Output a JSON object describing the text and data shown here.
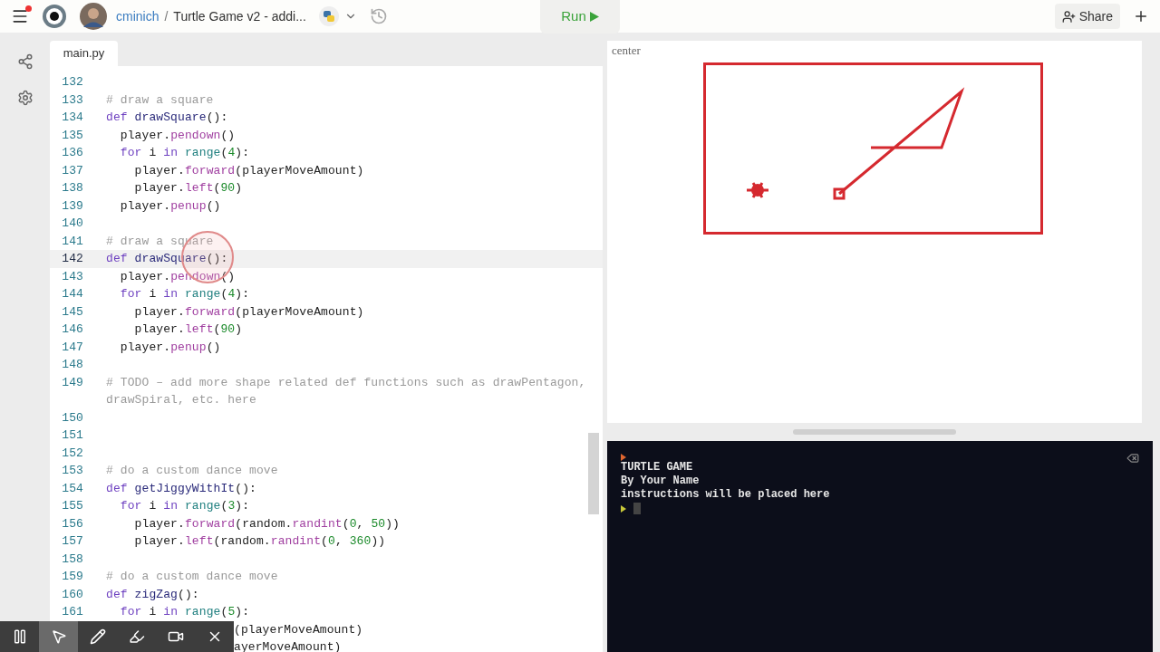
{
  "header": {
    "menu_badge": true,
    "user": "cminich",
    "separator": "/",
    "project": "Turtle Game v2 - addi...",
    "run_label": "Run",
    "share_label": "Share"
  },
  "editor": {
    "tab": "main.py",
    "lines": [
      {
        "number": "132",
        "active": false
      },
      {
        "number": "133",
        "active": false,
        "tokens": [
          {
            "kind": "comment",
            "text": "# draw a square"
          }
        ]
      },
      {
        "number": "134",
        "active": false,
        "tokens": [
          {
            "kind": "kw",
            "text": "def "
          },
          {
            "kind": "defname",
            "text": "drawSquare"
          },
          {
            "kind": "plain",
            "text": "():"
          }
        ]
      },
      {
        "number": "135",
        "active": false,
        "tokens": [
          {
            "kind": "plain",
            "text": "  player."
          },
          {
            "kind": "method",
            "text": "pendown"
          },
          {
            "kind": "plain",
            "text": "()"
          }
        ]
      },
      {
        "number": "136",
        "active": false,
        "tokens": [
          {
            "kind": "kw",
            "text": "  for"
          },
          {
            "kind": "plain",
            "text": " i "
          },
          {
            "kind": "kw",
            "text": "in "
          },
          {
            "kind": "builtin",
            "text": "range"
          },
          {
            "kind": "plain",
            "text": "("
          },
          {
            "kind": "num",
            "text": "4"
          },
          {
            "kind": "plain",
            "text": "):"
          }
        ]
      },
      {
        "number": "137",
        "active": false,
        "tokens": [
          {
            "kind": "plain",
            "text": "    player."
          },
          {
            "kind": "method",
            "text": "forward"
          },
          {
            "kind": "plain",
            "text": "(playerMoveAmount)"
          }
        ]
      },
      {
        "number": "138",
        "active": false,
        "tokens": [
          {
            "kind": "plain",
            "text": "    player."
          },
          {
            "kind": "method",
            "text": "left"
          },
          {
            "kind": "plain",
            "text": "("
          },
          {
            "kind": "num",
            "text": "90"
          },
          {
            "kind": "plain",
            "text": ")"
          }
        ]
      },
      {
        "number": "139",
        "active": false,
        "tokens": [
          {
            "kind": "plain",
            "text": "  player."
          },
          {
            "kind": "method",
            "text": "penup"
          },
          {
            "kind": "plain",
            "text": "()"
          }
        ]
      },
      {
        "number": "140",
        "active": false
      },
      {
        "number": "141",
        "active": false,
        "tokens": [
          {
            "kind": "comment",
            "text": "# draw a square"
          }
        ]
      },
      {
        "number": "142",
        "active": true,
        "tokens": [
          {
            "kind": "kw",
            "text": "def "
          },
          {
            "kind": "defname",
            "text": "drawSquare"
          },
          {
            "kind": "plain",
            "text": "():"
          }
        ]
      },
      {
        "number": "143",
        "active": false,
        "tokens": [
          {
            "kind": "plain",
            "text": "  player."
          },
          {
            "kind": "method",
            "text": "pendown"
          },
          {
            "kind": "plain",
            "text": "()"
          }
        ]
      },
      {
        "number": "144",
        "active": false,
        "tokens": [
          {
            "kind": "kw",
            "text": "  for"
          },
          {
            "kind": "plain",
            "text": " i "
          },
          {
            "kind": "kw",
            "text": "in "
          },
          {
            "kind": "builtin",
            "text": "range"
          },
          {
            "kind": "plain",
            "text": "("
          },
          {
            "kind": "num",
            "text": "4"
          },
          {
            "kind": "plain",
            "text": "):"
          }
        ]
      },
      {
        "number": "145",
        "active": false,
        "tokens": [
          {
            "kind": "plain",
            "text": "    player."
          },
          {
            "kind": "method",
            "text": "forward"
          },
          {
            "kind": "plain",
            "text": "(playerMoveAmount)"
          }
        ]
      },
      {
        "number": "146",
        "active": false,
        "tokens": [
          {
            "kind": "plain",
            "text": "    player."
          },
          {
            "kind": "method",
            "text": "left"
          },
          {
            "kind": "plain",
            "text": "("
          },
          {
            "kind": "num",
            "text": "90"
          },
          {
            "kind": "plain",
            "text": ")"
          }
        ]
      },
      {
        "number": "147",
        "active": false,
        "tokens": [
          {
            "kind": "plain",
            "text": "  player."
          },
          {
            "kind": "method",
            "text": "penup"
          },
          {
            "kind": "plain",
            "text": "()"
          }
        ]
      },
      {
        "number": "148",
        "active": false
      },
      {
        "number": "149",
        "active": false,
        "tokens": [
          {
            "kind": "comment",
            "text": "# TODO – add more shape related def functions such as drawPentagon, drawSpiral, etc. here"
          }
        ]
      },
      {
        "number": "150",
        "active": false
      },
      {
        "number": "151",
        "active": false
      },
      {
        "number": "152",
        "active": false
      },
      {
        "number": "153",
        "active": false,
        "tokens": [
          {
            "kind": "comment",
            "text": "# do a custom dance move"
          }
        ]
      },
      {
        "number": "154",
        "active": false,
        "tokens": [
          {
            "kind": "kw",
            "text": "def "
          },
          {
            "kind": "defname",
            "text": "getJiggyWithIt"
          },
          {
            "kind": "plain",
            "text": "():"
          }
        ]
      },
      {
        "number": "155",
        "active": false,
        "tokens": [
          {
            "kind": "kw",
            "text": "  for"
          },
          {
            "kind": "plain",
            "text": " i "
          },
          {
            "kind": "kw",
            "text": "in "
          },
          {
            "kind": "builtin",
            "text": "range"
          },
          {
            "kind": "plain",
            "text": "("
          },
          {
            "kind": "num",
            "text": "3"
          },
          {
            "kind": "plain",
            "text": "):"
          }
        ]
      },
      {
        "number": "156",
        "active": false,
        "tokens": [
          {
            "kind": "plain",
            "text": "    player."
          },
          {
            "kind": "method",
            "text": "forward"
          },
          {
            "kind": "plain",
            "text": "(random."
          },
          {
            "kind": "method",
            "text": "randint"
          },
          {
            "kind": "plain",
            "text": "("
          },
          {
            "kind": "num",
            "text": "0"
          },
          {
            "kind": "plain",
            "text": ", "
          },
          {
            "kind": "num",
            "text": "50"
          },
          {
            "kind": "plain",
            "text": "))"
          }
        ]
      },
      {
        "number": "157",
        "active": false,
        "tokens": [
          {
            "kind": "plain",
            "text": "    player."
          },
          {
            "kind": "method",
            "text": "left"
          },
          {
            "kind": "plain",
            "text": "(random."
          },
          {
            "kind": "method",
            "text": "randint"
          },
          {
            "kind": "plain",
            "text": "("
          },
          {
            "kind": "num",
            "text": "0"
          },
          {
            "kind": "plain",
            "text": ", "
          },
          {
            "kind": "num",
            "text": "360"
          },
          {
            "kind": "plain",
            "text": "))"
          }
        ]
      },
      {
        "number": "158",
        "active": false
      },
      {
        "number": "159",
        "active": false,
        "tokens": [
          {
            "kind": "comment",
            "text": "# do a custom dance move"
          }
        ]
      },
      {
        "number": "160",
        "active": false,
        "tokens": [
          {
            "kind": "kw",
            "text": "def "
          },
          {
            "kind": "defname",
            "text": "zigZag"
          },
          {
            "kind": "plain",
            "text": "():"
          }
        ]
      },
      {
        "number": "161",
        "active": false,
        "tokens": [
          {
            "kind": "kw",
            "text": "  for"
          },
          {
            "kind": "plain",
            "text": " i "
          },
          {
            "kind": "kw",
            "text": "in "
          },
          {
            "kind": "builtin",
            "text": "range"
          },
          {
            "kind": "plain",
            "text": "("
          },
          {
            "kind": "num",
            "text": "5"
          },
          {
            "kind": "plain",
            "text": "):"
          }
        ]
      },
      {
        "kind": "partial",
        "active": false,
        "tokens": [
          {
            "kind": "plain",
            "text": "(playerMoveAmount)"
          }
        ]
      },
      {
        "kind": "partial",
        "active": false,
        "tokens": [
          {
            "kind": "plain",
            "text": "ayerMoveAmount)"
          }
        ]
      }
    ]
  },
  "canvas": {
    "label": "center"
  },
  "console": {
    "lines": [
      "TURTLE GAME",
      "By Your Name",
      "instructions will be placed here"
    ]
  },
  "recorder_toolbar": [
    {
      "kind": "pause",
      "selected": false
    },
    {
      "kind": "pointer",
      "selected": true
    },
    {
      "kind": "pen",
      "selected": false
    },
    {
      "kind": "highlighter",
      "selected": false
    },
    {
      "kind": "camera",
      "selected": false
    },
    {
      "kind": "close",
      "selected": false
    }
  ]
}
